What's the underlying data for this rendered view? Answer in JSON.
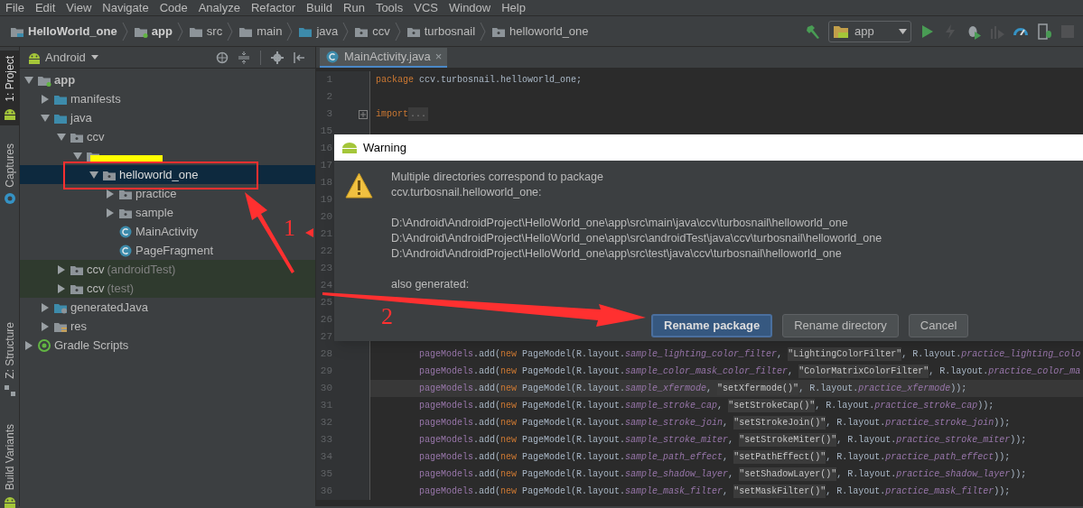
{
  "menu_bar": [
    "File",
    "Edit",
    "View",
    "Navigate",
    "Code",
    "Analyze",
    "Refactor",
    "Build",
    "Run",
    "Tools",
    "VCS",
    "Window",
    "Help"
  ],
  "breadcrumbs": [
    {
      "label": "HelloWorld_one",
      "kind": "project"
    },
    {
      "label": "app",
      "kind": "module"
    },
    {
      "label": "src",
      "kind": "folder"
    },
    {
      "label": "main",
      "kind": "folder"
    },
    {
      "label": "java",
      "kind": "source"
    },
    {
      "label": "ccv",
      "kind": "package"
    },
    {
      "label": "turbosnail",
      "kind": "package"
    },
    {
      "label": "helloworld_one",
      "kind": "package"
    }
  ],
  "run_config": {
    "label": "app"
  },
  "toolbar": [
    {
      "kind": "run",
      "disabled": false
    },
    {
      "kind": "apply",
      "disabled": true
    },
    {
      "kind": "debug",
      "disabled": false
    },
    {
      "kind": "attach",
      "disabled": true
    },
    {
      "kind": "profile",
      "disabled": false
    },
    {
      "kind": "device",
      "disabled": false
    },
    {
      "kind": "stop",
      "disabled": true
    }
  ],
  "side_tabs": [
    {
      "label": "1: Project",
      "selected": true,
      "kind": "project"
    },
    {
      "label": "Captures",
      "selected": false,
      "kind": "captures"
    },
    {
      "label": "Z: Structure",
      "selected": false,
      "kind": "structure"
    },
    {
      "label": "Build Variants",
      "selected": false,
      "kind": "variants"
    }
  ],
  "project_panel": {
    "view": "Android",
    "tree": [
      {
        "label": "app",
        "kind": "module",
        "expanded": true,
        "selected": false,
        "children": [
          {
            "label": "manifests",
            "kind": "source",
            "expanded": false,
            "selected": false
          },
          {
            "label": "java",
            "kind": "source",
            "expanded": true,
            "selected": false,
            "children": [
              {
                "label": "ccv",
                "kind": "package",
                "expanded": true,
                "selected": false,
                "children": [
                  {
                    "redacted": true,
                    "kind": "package",
                    "expanded": true,
                    "selected": false,
                    "children": [
                      {
                        "label": "helloworld_one",
                        "kind": "package",
                        "expanded": true,
                        "selected": true,
                        "children": [
                          {
                            "label": "practice",
                            "kind": "package",
                            "expanded": false,
                            "selected": false
                          },
                          {
                            "label": "sample",
                            "kind": "package",
                            "expanded": false,
                            "selected": false
                          },
                          {
                            "label": "MainActivity",
                            "kind": "class",
                            "selected": false
                          },
                          {
                            "label": "PageFragment",
                            "kind": "class",
                            "selected": false
                          }
                        ]
                      }
                    ]
                  }
                ]
              },
              {
                "label": "ccv",
                "suffix": "(androidTest)",
                "kind": "test-package",
                "expanded": false,
                "selected": false
              },
              {
                "label": "ccv",
                "suffix": "(test)",
                "kind": "test-package",
                "expanded": false,
                "selected": false
              }
            ]
          },
          {
            "label": "generatedJava",
            "kind": "generated",
            "expanded": false,
            "selected": false
          },
          {
            "label": "res",
            "kind": "res",
            "expanded": false,
            "selected": false
          }
        ]
      },
      {
        "label": "Gradle Scripts",
        "kind": "gradle",
        "expanded": false,
        "selected": false
      }
    ]
  },
  "editor": {
    "tab": {
      "label": "MainActivity.java",
      "close": "×"
    },
    "lines": [
      {
        "number": "1",
        "kind": "top",
        "current": false,
        "tokens": [
          {
            "kind": "keyword",
            "text": "package"
          },
          {
            "kind": "plain",
            "text": " ccv.turbosnail.helloworld_one;"
          }
        ]
      },
      {
        "number": "2"
      },
      {
        "number": "3",
        "kind": "top",
        "current": false,
        "folded": true,
        "tokens": [
          {
            "kind": "keyword",
            "text": "import"
          },
          {
            "kind": "fold",
            "text": "..."
          }
        ]
      },
      {
        "number": "15"
      },
      {
        "number": "16"
      },
      {
        "number": "17"
      },
      {
        "number": "18"
      },
      {
        "number": "19"
      },
      {
        "number": "20"
      },
      {
        "number": "21"
      },
      {
        "number": "22"
      },
      {
        "number": "23"
      },
      {
        "number": "24"
      },
      {
        "number": "25"
      },
      {
        "number": "26"
      },
      {
        "number": "27"
      },
      {
        "number": "28",
        "kind": "body",
        "current": false,
        "tokens": [
          {
            "kind": "member",
            "text": "pageModels"
          },
          {
            "kind": "plain",
            "text": ".add("
          },
          {
            "kind": "keyword",
            "text": "new"
          },
          {
            "kind": "plain",
            "text": " PageModel(R.layout."
          },
          {
            "kind": "field",
            "text": "sample_lighting_color_filter"
          },
          {
            "kind": "plain",
            "text": ", "
          },
          {
            "kind": "string",
            "text": "\"LightingColorFilter\""
          },
          {
            "kind": "plain",
            "text": ", R.layout."
          },
          {
            "kind": "field",
            "text": "practice_lighting_colo"
          }
        ]
      },
      {
        "number": "29",
        "kind": "body",
        "current": false,
        "tokens": [
          {
            "kind": "member",
            "text": "pageModels"
          },
          {
            "kind": "plain",
            "text": ".add("
          },
          {
            "kind": "keyword",
            "text": "new"
          },
          {
            "kind": "plain",
            "text": " PageModel(R.layout."
          },
          {
            "kind": "field",
            "text": "sample_color_mask_color_filter"
          },
          {
            "kind": "plain",
            "text": ", "
          },
          {
            "kind": "string",
            "text": "\"ColorMatrixColorFilter\""
          },
          {
            "kind": "plain",
            "text": ", R.layout."
          },
          {
            "kind": "field",
            "text": "practice_color_ma"
          }
        ]
      },
      {
        "number": "30",
        "kind": "body",
        "current": true,
        "tokens": [
          {
            "kind": "member",
            "text": "pageModels"
          },
          {
            "kind": "plain",
            "text": ".add("
          },
          {
            "kind": "keyword",
            "text": "new"
          },
          {
            "kind": "plain",
            "text": " PageModel(R.layout."
          },
          {
            "kind": "field",
            "text": "sample_xfermode"
          },
          {
            "kind": "plain",
            "text": ", "
          },
          {
            "kind": "string",
            "text": "\"setXfermode()\""
          },
          {
            "kind": "plain",
            "text": ", R.layout."
          },
          {
            "kind": "field",
            "text": "practice_xfermode"
          },
          {
            "kind": "plain",
            "text": "));"
          }
        ]
      },
      {
        "number": "31",
        "kind": "body",
        "current": false,
        "tokens": [
          {
            "kind": "member",
            "text": "pageModels"
          },
          {
            "kind": "plain",
            "text": ".add("
          },
          {
            "kind": "keyword",
            "text": "new"
          },
          {
            "kind": "plain",
            "text": " PageModel(R.layout."
          },
          {
            "kind": "field",
            "text": "sample_stroke_cap"
          },
          {
            "kind": "plain",
            "text": ", "
          },
          {
            "kind": "string",
            "text": "\"setStrokeCap()\""
          },
          {
            "kind": "plain",
            "text": ", R.layout."
          },
          {
            "kind": "field",
            "text": "practice_stroke_cap"
          },
          {
            "kind": "plain",
            "text": "));"
          }
        ]
      },
      {
        "number": "32",
        "kind": "body",
        "current": false,
        "tokens": [
          {
            "kind": "member",
            "text": "pageModels"
          },
          {
            "kind": "plain",
            "text": ".add("
          },
          {
            "kind": "keyword",
            "text": "new"
          },
          {
            "kind": "plain",
            "text": " PageModel(R.layout."
          },
          {
            "kind": "field",
            "text": "sample_stroke_join"
          },
          {
            "kind": "plain",
            "text": ", "
          },
          {
            "kind": "string",
            "text": "\"setStrokeJoin()\""
          },
          {
            "kind": "plain",
            "text": ", R.layout."
          },
          {
            "kind": "field",
            "text": "practice_stroke_join"
          },
          {
            "kind": "plain",
            "text": "));"
          }
        ]
      },
      {
        "number": "33",
        "kind": "body",
        "current": false,
        "tokens": [
          {
            "kind": "member",
            "text": "pageModels"
          },
          {
            "kind": "plain",
            "text": ".add("
          },
          {
            "kind": "keyword",
            "text": "new"
          },
          {
            "kind": "plain",
            "text": " PageModel(R.layout."
          },
          {
            "kind": "field",
            "text": "sample_stroke_miter"
          },
          {
            "kind": "plain",
            "text": ", "
          },
          {
            "kind": "string",
            "text": "\"setStrokeMiter()\""
          },
          {
            "kind": "plain",
            "text": ", R.layout."
          },
          {
            "kind": "field",
            "text": "practice_stroke_miter"
          },
          {
            "kind": "plain",
            "text": "));"
          }
        ]
      },
      {
        "number": "34",
        "kind": "body",
        "current": false,
        "tokens": [
          {
            "kind": "member",
            "text": "pageModels"
          },
          {
            "kind": "plain",
            "text": ".add("
          },
          {
            "kind": "keyword",
            "text": "new"
          },
          {
            "kind": "plain",
            "text": " PageModel(R.layout."
          },
          {
            "kind": "field",
            "text": "sample_path_effect"
          },
          {
            "kind": "plain",
            "text": ", "
          },
          {
            "kind": "string",
            "text": "\"setPathEffect()\""
          },
          {
            "kind": "plain",
            "text": ", R.layout."
          },
          {
            "kind": "field",
            "text": "practice_path_effect"
          },
          {
            "kind": "plain",
            "text": "));"
          }
        ]
      },
      {
        "number": "35",
        "kind": "body",
        "current": false,
        "tokens": [
          {
            "kind": "member",
            "text": "pageModels"
          },
          {
            "kind": "plain",
            "text": ".add("
          },
          {
            "kind": "keyword",
            "text": "new"
          },
          {
            "kind": "plain",
            "text": " PageModel(R.layout."
          },
          {
            "kind": "field",
            "text": "sample_shadow_layer"
          },
          {
            "kind": "plain",
            "text": ", "
          },
          {
            "kind": "string",
            "text": "\"setShadowLayer()\""
          },
          {
            "kind": "plain",
            "text": ", R.layout."
          },
          {
            "kind": "field",
            "text": "practice_shadow_layer"
          },
          {
            "kind": "plain",
            "text": "));"
          }
        ]
      },
      {
        "number": "36",
        "kind": "body",
        "current": false,
        "tokens": [
          {
            "kind": "member",
            "text": "pageModels"
          },
          {
            "kind": "plain",
            "text": ".add("
          },
          {
            "kind": "keyword",
            "text": "new"
          },
          {
            "kind": "plain",
            "text": " PageModel(R.layout."
          },
          {
            "kind": "field",
            "text": "sample_mask_filter"
          },
          {
            "kind": "plain",
            "text": ", "
          },
          {
            "kind": "string",
            "text": "\"setMaskFilter()\""
          },
          {
            "kind": "plain",
            "text": ", R.layout."
          },
          {
            "kind": "field",
            "text": "practice_mask_filter"
          },
          {
            "kind": "plain",
            "text": "));"
          }
        ]
      }
    ]
  },
  "dialog": {
    "title": "Warning",
    "message": [
      "Multiple directories correspond to package",
      "ccv.turbosnail.helloworld_one:"
    ],
    "paths": [
      "D:\\Android\\AndroidProject\\HelloWorld_one\\app\\src\\main\\java\\ccv\\turbosnail\\helloworld_one",
      "D:\\Android\\AndroidProject\\HelloWorld_one\\app\\src\\androidTest\\java\\ccv\\turbosnail\\helloworld_one",
      "D:\\Android\\AndroidProject\\HelloWorld_one\\app\\src\\test\\java\\ccv\\turbosnail\\helloworld_one"
    ],
    "note": "also generated:",
    "buttons": [
      {
        "label": "Rename package",
        "default": true
      },
      {
        "label": "Rename directory",
        "default": false
      },
      {
        "label": "Cancel",
        "default": false
      }
    ]
  },
  "annotations": [
    {
      "text": "1"
    },
    {
      "text": "2"
    }
  ]
}
